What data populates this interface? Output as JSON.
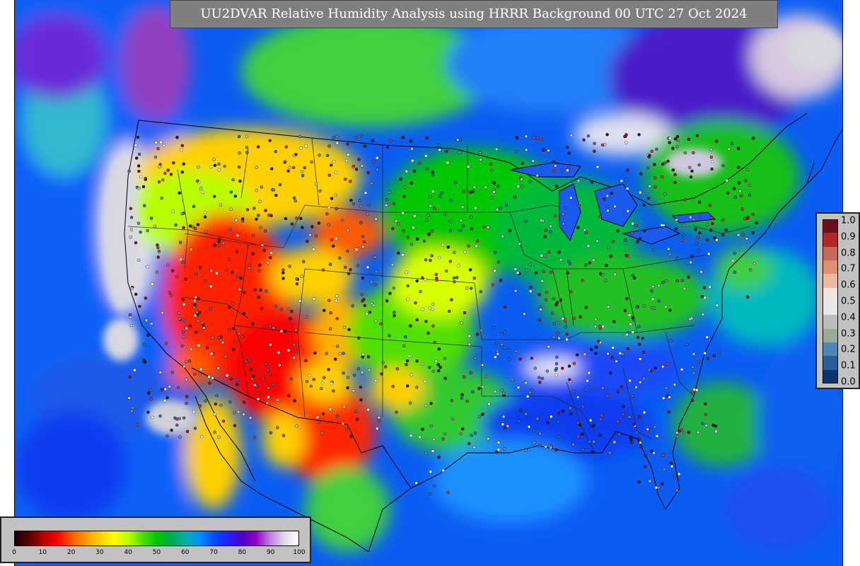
{
  "title": "UU2DVAR Relative Humidity Analysis using HRRR Background 00 UTC 27 Oct 2024",
  "map": {
    "background_field": "relative humidity analysis (%)",
    "overlays": [
      "country-borders",
      "state-borders",
      "coastlines",
      "great-lakes",
      "observation-dots"
    ]
  },
  "rh_colorbar": {
    "ticks": [
      "0",
      "10",
      "20",
      "30",
      "40",
      "50",
      "60",
      "70",
      "80",
      "90",
      "100"
    ],
    "colors": [
      "#1a0000",
      "#5a0000",
      "#b80000",
      "#ff0000",
      "#ff5a00",
      "#ff9a00",
      "#ffd000",
      "#ffff00",
      "#b8ff00",
      "#50e000",
      "#00c800",
      "#00a850",
      "#00b0a8",
      "#0090ff",
      "#0050ff",
      "#2020ff",
      "#5000c8",
      "#9000c0",
      "#c080e0",
      "#e0d8e8",
      "#ffffff"
    ]
  },
  "ob_colorbar": {
    "ticks": [
      "1.0",
      "0.9",
      "0.8",
      "0.7",
      "0.6",
      "0.5",
      "0.4",
      "0.3",
      "0.2",
      "0.1",
      "0.0"
    ],
    "colors": [
      "#6e0f1e",
      "#b52626",
      "#c86a5a",
      "#e0906e",
      "#f0b8a0",
      "#f0e6e0",
      "#e8e8e8",
      "#bcbcbc",
      "#9aaa9a",
      "#4f86b8",
      "#2a5d9a",
      "#0c3470"
    ]
  }
}
